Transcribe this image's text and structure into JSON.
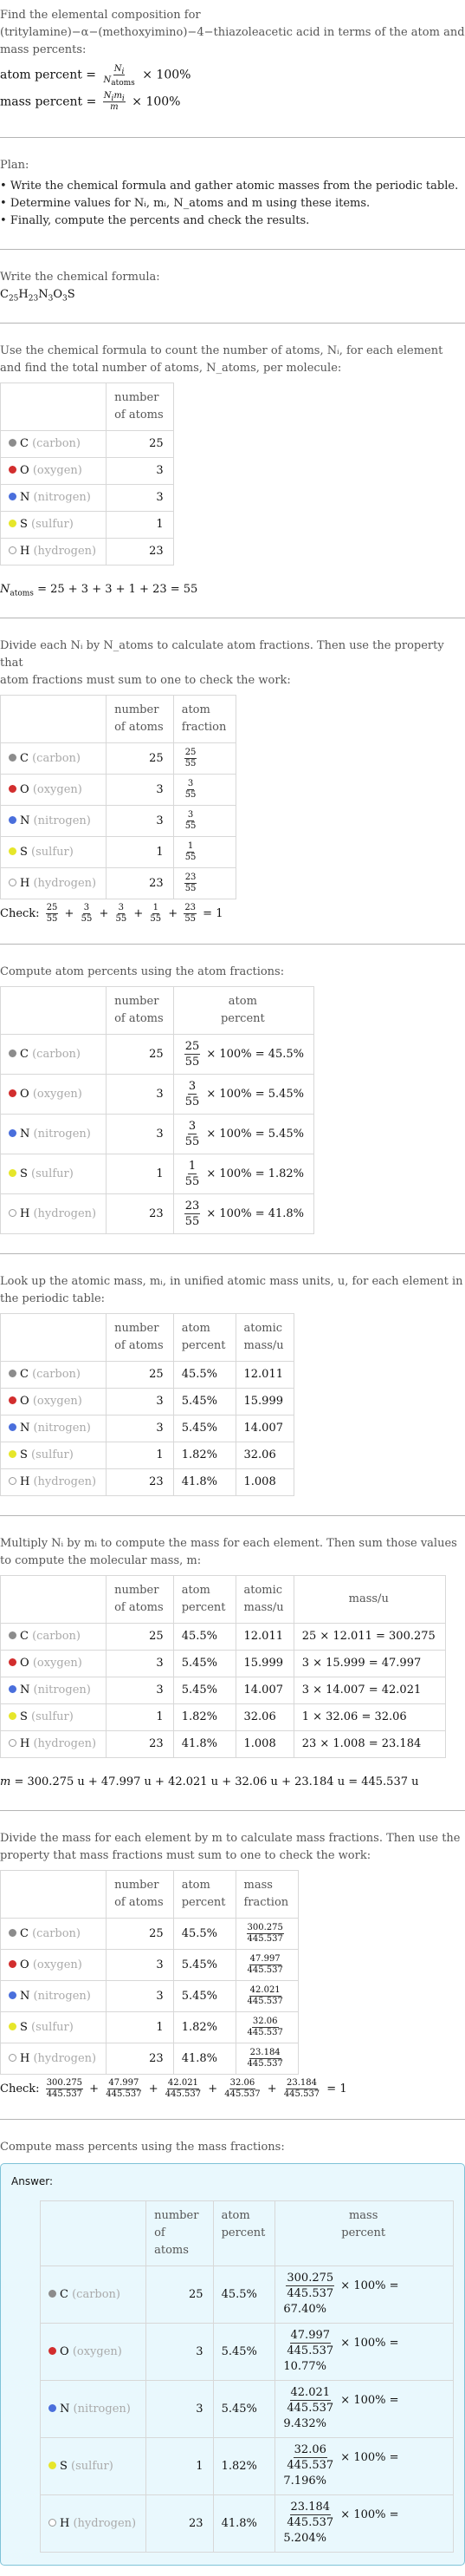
{
  "intro": {
    "line1": "Find the elemental composition for",
    "line2": "(tritylamine)−α−(methoxyimino)−4−thiazoleacetic acid in terms of the atom and",
    "line3": "mass percents:",
    "atom_percent_label": "atom percent =",
    "mass_percent_label": "mass percent =",
    "times_100": "× 100%"
  },
  "plan": {
    "title": "Plan:",
    "items": [
      "Write the chemical formula and gather atomic masses from the periodic table.",
      "Determine values for Nᵢ, mᵢ, N_atoms and m using these items.",
      "Finally, compute the percents and check the results."
    ]
  },
  "formula": {
    "title": "Write the chemical formula:",
    "parts": [
      {
        "el": "C",
        "n": "25"
      },
      {
        "el": "H",
        "n": "23"
      },
      {
        "el": "N",
        "n": "3"
      },
      {
        "el": "O",
        "n": "3"
      },
      {
        "el": "S",
        "n": ""
      }
    ]
  },
  "headers": {
    "number_of_atoms": [
      "number",
      "of atoms"
    ],
    "atom_fraction": [
      "atom",
      "fraction"
    ],
    "atom_percent": [
      "atom",
      "percent"
    ],
    "atomic_mass": [
      "atomic",
      "mass/u"
    ],
    "mass": "mass/u",
    "mass_fraction": [
      "mass",
      "fraction"
    ],
    "mass_percent": [
      "mass",
      "percent"
    ]
  },
  "elements": [
    {
      "symbol": "C",
      "name": "(carbon)",
      "color": "#8c8c8c",
      "count": "25",
      "atom_percent": "45.5%",
      "atomic_mass": "12.011",
      "mass": "300.275",
      "mass_calc": "25 × 12.011 = 300.275",
      "atom_pct_result": "45.5%",
      "mass_pct_result": "67.40%"
    },
    {
      "symbol": "O",
      "name": "(oxygen)",
      "color": "#d22e2e",
      "count": "3",
      "atom_percent": "5.45%",
      "atomic_mass": "15.999",
      "mass": "47.997",
      "mass_calc": "3 × 15.999 = 47.997",
      "atom_pct_result": "5.45%",
      "mass_pct_result": "10.77%"
    },
    {
      "symbol": "N",
      "name": "(nitrogen)",
      "color": "#4a6fdc",
      "count": "3",
      "atom_percent": "5.45%",
      "atomic_mass": "14.007",
      "mass": "42.021",
      "mass_calc": "3 × 14.007 = 42.021",
      "atom_pct_result": "5.45%",
      "mass_pct_result": "9.432%"
    },
    {
      "symbol": "S",
      "name": "(sulfur)",
      "color": "#e6e62a",
      "count": "1",
      "atom_percent": "1.82%",
      "atomic_mass": "32.06",
      "mass": "32.06",
      "mass_calc": "1 × 32.06 = 32.06",
      "atom_pct_result": "1.82%",
      "mass_pct_result": "7.196%"
    },
    {
      "symbol": "H",
      "name": "(hydrogen)",
      "color": "#ffffff",
      "count": "23",
      "atom_percent": "41.8%",
      "atomic_mass": "1.008",
      "mass": "23.184",
      "mass_calc": "23 × 1.008 = 23.184",
      "atom_pct_result": "41.8%",
      "mass_pct_result": "5.204%"
    }
  ],
  "step_count": {
    "text1": "Use the chemical formula to count the number of atoms, Nᵢ, for each element",
    "text2": "and find the total number of atoms, N_atoms, per molecule:",
    "total_eq": "= 25 + 3 + 3 + 1 + 23 = 55"
  },
  "step_fraction": {
    "text1": "Divide each Nᵢ by N_atoms to calculate atom fractions. Then use the property that",
    "text2": "atom fractions must sum to one to check the work:",
    "total_atoms": "55",
    "check_label": "Check:",
    "check_result": "= 1"
  },
  "step_atom_percent": {
    "text": "Compute atom percents using the atom fractions:"
  },
  "step_atomic_mass": {
    "text1": "Look up the atomic mass, mᵢ, in unified atomic mass units, u, for each element in",
    "text2": "the periodic table:"
  },
  "step_mass": {
    "text1": "Multiply Nᵢ by mᵢ to compute the mass for each element. Then sum those values",
    "text2": "to compute the molecular mass, m:",
    "sum_eq": "= 300.275 u + 47.997 u + 42.021 u + 32.06 u + 23.184 u = 445.537 u",
    "molecular_mass": "445.537"
  },
  "step_mass_fraction": {
    "text1": "Divide the mass for each element by m to calculate mass fractions. Then use the",
    "text2": "property that mass fractions must sum to one to check the work:",
    "check_label": "Check:",
    "check_result": "= 1"
  },
  "step_mass_percent": {
    "text": "Compute mass percents using the mass fractions:",
    "answer_label": "Answer:"
  }
}
